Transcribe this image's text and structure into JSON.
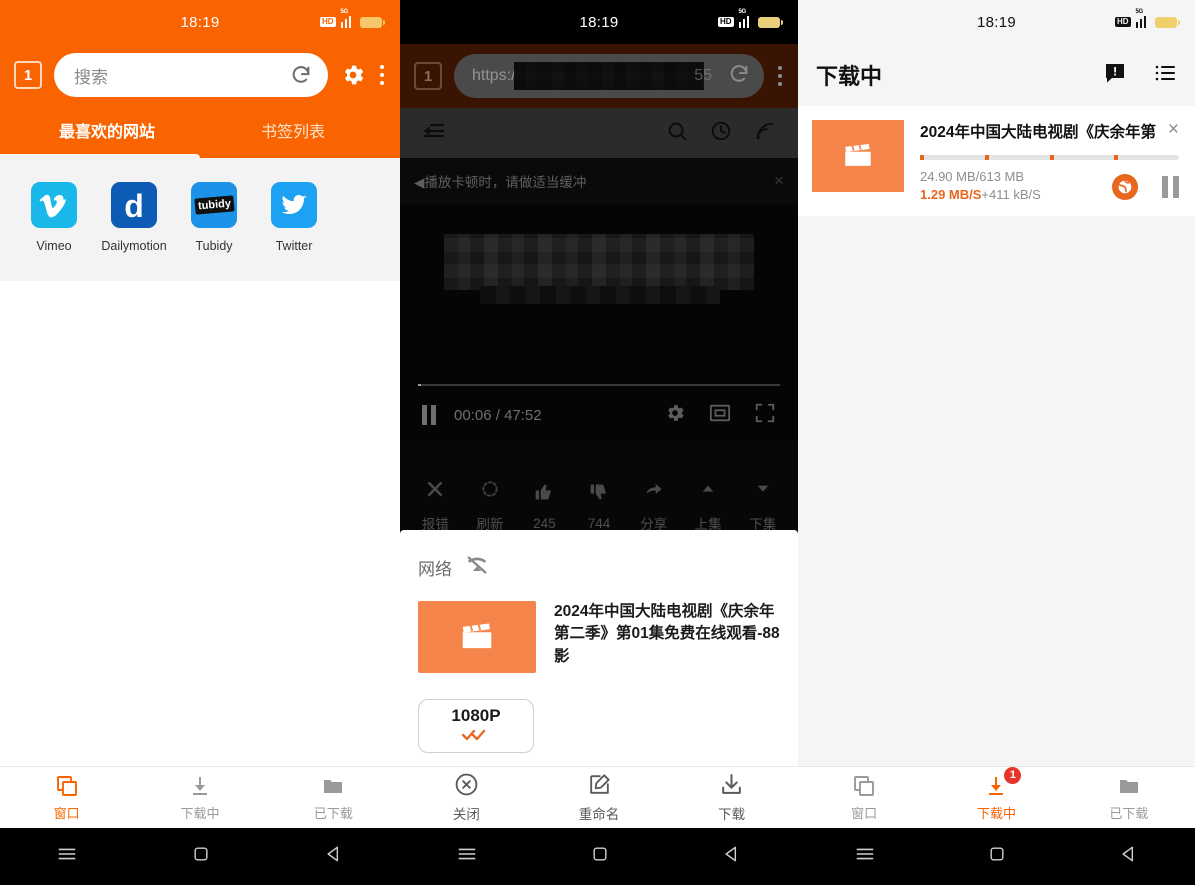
{
  "statusbar": {
    "time": "18:19",
    "hd": "HD",
    "network": "5G"
  },
  "panel1": {
    "tab_count": "1",
    "search_placeholder": "搜索",
    "icons": {
      "reload": "reload-icon",
      "settings": "gear-icon",
      "menu": "kebab-menu-icon"
    },
    "tabs": [
      {
        "label": "最喜欢的网站",
        "active": true
      },
      {
        "label": "书签列表",
        "active": false
      }
    ],
    "favorites": [
      {
        "label": "Vimeo",
        "mark": "v"
      },
      {
        "label": "Dailymotion",
        "mark": "d"
      },
      {
        "label": "Tubidy",
        "mark": "tubidy"
      },
      {
        "label": "Twitter",
        "mark": "bird"
      }
    ],
    "bottom_nav": [
      {
        "label": "窗口",
        "icon": "windows-icon",
        "active": true
      },
      {
        "label": "下载中",
        "icon": "download-icon",
        "active": false
      },
      {
        "label": "已下载",
        "icon": "folder-icon",
        "active": false
      }
    ]
  },
  "panel2": {
    "tab_count": "1",
    "url_prefix": "https://",
    "url_tail": "55",
    "toolbar_icons": [
      "indent-list-icon",
      "search-icon",
      "history-clock-icon",
      "rss-icon"
    ],
    "notice": "◀播放卡顿时，请做适当缓冲",
    "notice_close": "×",
    "player": {
      "current_time": "00:06",
      "total_time": "47:52",
      "separator": "/",
      "state": "paused",
      "icons": [
        "pause-icon",
        "gear-icon",
        "pip-icon",
        "fullscreen-icon"
      ]
    },
    "actions": [
      {
        "label": "报错",
        "icon": "close-x-icon"
      },
      {
        "label": "刷新",
        "icon": "spinner-refresh-icon"
      },
      {
        "label": "245",
        "icon": "thumbs-up-icon"
      },
      {
        "label": "744",
        "icon": "thumbs-down-icon"
      },
      {
        "label": "分享",
        "icon": "share-arrow-icon"
      },
      {
        "label": "上集",
        "icon": "chevron-up-icon"
      },
      {
        "label": "下集",
        "icon": "chevron-down-icon"
      }
    ],
    "dialog": {
      "network_label": "网络",
      "network_icon": "wifi-off-icon",
      "video_title": "2024年中国大陆电视剧《庆余年第二季》第01集免费在线观看-88影",
      "thumb_icon": "clapperboard-icon",
      "quality": "1080P",
      "quality_checked_icon": "double-check-icon",
      "buttons": [
        {
          "label": "关闭",
          "icon": "close-circle-icon"
        },
        {
          "label": "重命名",
          "icon": "rename-pencil-icon"
        },
        {
          "label": "下载",
          "icon": "download-tray-icon"
        }
      ]
    }
  },
  "panel3": {
    "title": "下载中",
    "header_icons": [
      {
        "name": "alert-message-icon"
      },
      {
        "name": "list-icon"
      }
    ],
    "download": {
      "title": "2024年中国大陆电视剧《庆余年第",
      "thumb_icon": "clapperboard-icon",
      "close": "×",
      "size": "24.90 MB/613 MB",
      "speed_primary": "1.29 MB/S",
      "speed_secondary": "+411 kB/S",
      "segments": [
        1,
        25,
        50,
        75
      ],
      "globe_icon": "globe-icon",
      "pause_icon": "pause-icon"
    },
    "bottom_nav": [
      {
        "label": "窗口",
        "icon": "windows-icon",
        "active": false,
        "badge": ""
      },
      {
        "label": "下载中",
        "icon": "download-icon",
        "active": true,
        "badge": "1"
      },
      {
        "label": "已下载",
        "icon": "folder-icon",
        "active": false,
        "badge": ""
      }
    ]
  },
  "sysnav": {
    "menu": "menu-icon",
    "home": "home-icon",
    "back": "back-icon"
  }
}
